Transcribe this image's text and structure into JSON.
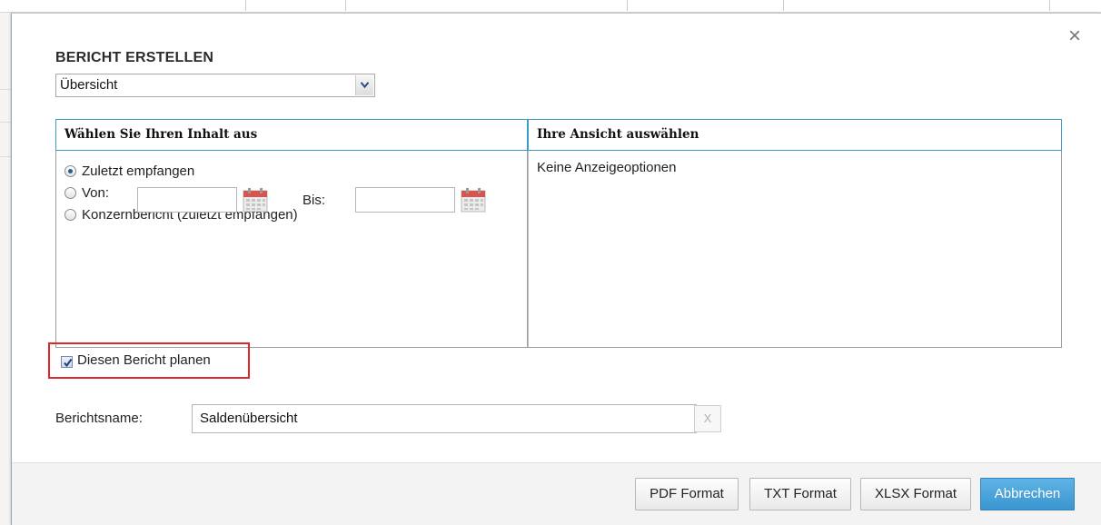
{
  "dialog": {
    "title": "BERICHT ERSTELLEN",
    "close_glyph": "×",
    "report_type": {
      "selected": "Übersicht"
    }
  },
  "content_panel": {
    "header": "Wählen Sie Ihren Inhalt aus",
    "options": [
      {
        "label": "Zuletzt empfangen",
        "checked": true
      },
      {
        "label": "Von:",
        "checked": false
      },
      {
        "label": "Konzernbericht (zuletzt empfangen)",
        "checked": false
      }
    ],
    "date_to_label": "Bis:",
    "date_from_value": "",
    "date_to_value": ""
  },
  "view_panel": {
    "header": "Ihre Ansicht auswählen",
    "text": "Keine Anzeigeoptionen"
  },
  "schedule": {
    "label": "Diesen Bericht planen",
    "checked": true,
    "highlight_color": "#e0262a"
  },
  "report_name": {
    "label": "Berichtsname:",
    "value": "Saldenübersicht",
    "clear_label": "X"
  },
  "footer": {
    "buttons": {
      "pdf": "PDF Format",
      "txt": "TXT Format",
      "xlsx": "XLSX Format",
      "cancel": "Abbrechen"
    }
  },
  "colors": {
    "accent": "#3f9cc8",
    "primary_button": "#3a95cf"
  }
}
